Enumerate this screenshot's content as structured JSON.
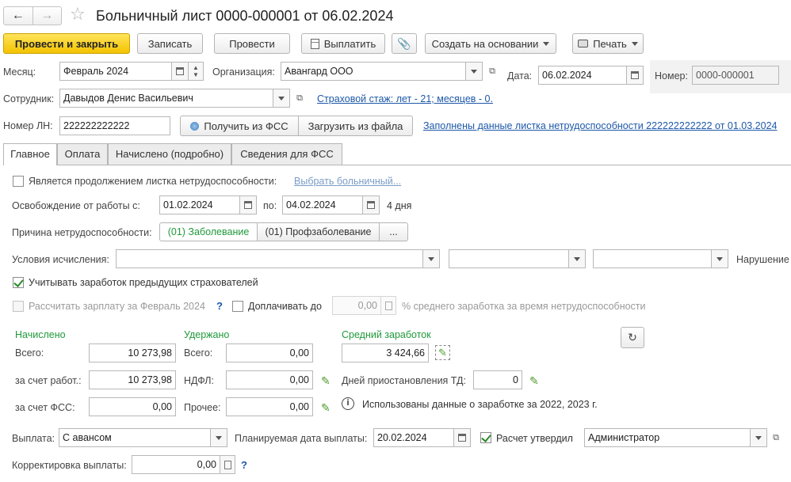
{
  "header": {
    "title": "Больничный лист 0000-000001 от 06.02.2024"
  },
  "toolbar": {
    "post_close": "Провести и закрыть",
    "save": "Записать",
    "post": "Провести",
    "pay": "Выплатить",
    "create_based": "Создать на основании",
    "print": "Печать"
  },
  "fields": {
    "month_label": "Месяц:",
    "month_value": "Февраль 2024",
    "org_label": "Организация:",
    "org_value": "Авангард ООО",
    "date_label": "Дата:",
    "date_value": "06.02.2024",
    "number_label": "Номер:",
    "number_value": "0000-000001",
    "employee_label": "Сотрудник:",
    "employee_value": "Давыдов Денис Васильевич",
    "insurance_link": "Страховой стаж: лет - 21; месяцев - 0.",
    "ln_label": "Номер ЛН:",
    "ln_value": "222222222222",
    "get_fss": "Получить из ФСС",
    "load_file": "Загрузить из файла",
    "filled_link": "Заполнены данные листка нетрудоспособности 222222222222 от 01.03.2024"
  },
  "tabs": [
    "Главное",
    "Оплата",
    "Начислено (подробно)",
    "Сведения для ФСС"
  ],
  "main": {
    "continuation_label": "Является продолжением листка нетрудоспособности:",
    "select_sick_link": "Выбрать больничный...",
    "release_label": "Освобождение от работы с:",
    "release_from": "01.02.2024",
    "to_label": "по:",
    "release_to": "04.02.2024",
    "days": "4 дня",
    "reason_label": "Причина нетрудоспособности:",
    "reason_options": [
      "(01) Заболевание",
      "(01) Профзаболевание",
      "..."
    ],
    "conditions_label": "Условия исчисления:",
    "violation_label": "Нарушение",
    "consider_prev_label": "Учитывать заработок предыдущих страхователей",
    "calc_salary_label": "Рассчитать зарплату за Февраль 2024",
    "pay_extra_label": "Доплачивать до",
    "pay_extra_value": "0,00",
    "pay_extra_suffix": "% среднего заработка за время нетрудоспособности"
  },
  "accrued": {
    "heading": "Начислено",
    "total_label": "Всего:",
    "total": "10 273,98",
    "employer_label": "за счет работ.:",
    "employer": "10 273,98",
    "fss_label": "за счет ФСС:",
    "fss": "0,00"
  },
  "withheld": {
    "heading": "Удержано",
    "total_label": "Всего:",
    "total": "0,00",
    "ndfl_label": "НДФЛ:",
    "ndfl": "0,00",
    "other_label": "Прочее:",
    "other": "0,00"
  },
  "average": {
    "heading": "Средний заработок",
    "value": "3 424,66",
    "suspension_label": "Дней приостановления ТД:",
    "suspension": "0",
    "info": "Использованы данные о заработке за  2022,  2023 г."
  },
  "payment": {
    "label": "Выплата:",
    "value": "С авансом",
    "planned_label": "Планируемая дата выплаты:",
    "planned_date": "20.02.2024",
    "approved_label": "Расчет утвердил",
    "approved_by": "Администратор",
    "correction_label": "Корректировка выплаты:",
    "correction": "0,00"
  },
  "icons": {
    "back": "arrow-left-icon",
    "forward": "arrow-right-icon",
    "favorite": "star-icon",
    "refresh": "refresh-icon",
    "info": "info-icon",
    "edit": "pencil-icon"
  },
  "colors": {
    "primary_button": "#f3c300",
    "accent_green": "#1f9a3a",
    "link": "#1d58a8"
  }
}
